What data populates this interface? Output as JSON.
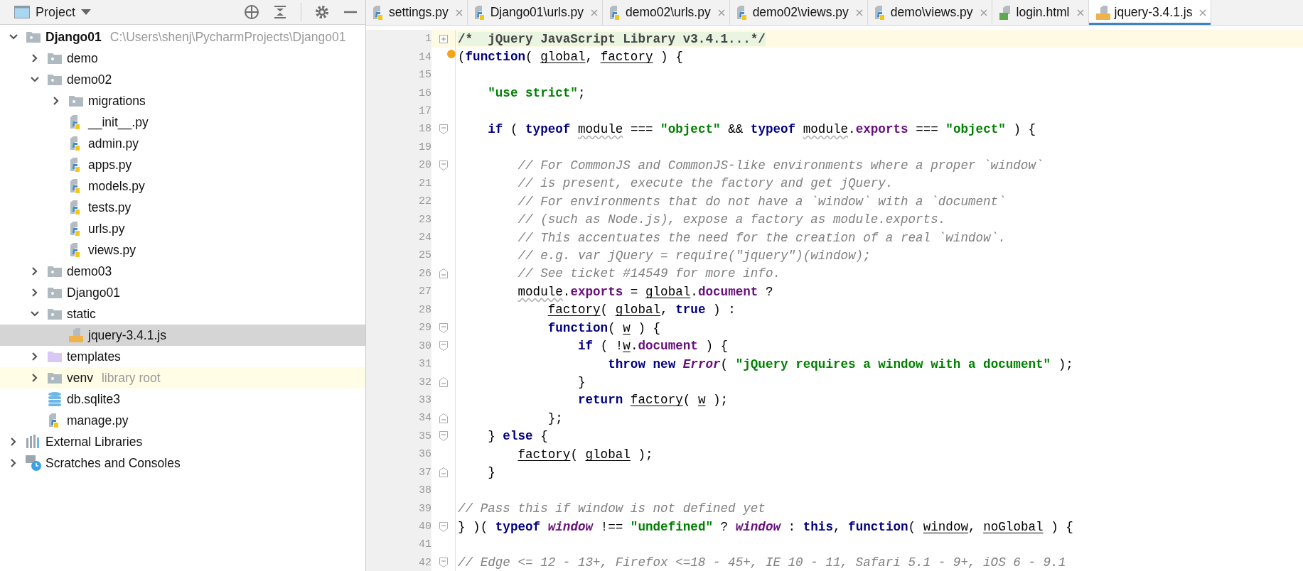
{
  "project_panel": {
    "title": "Project",
    "tree": [
      {
        "label": "Django01",
        "kind": "project",
        "hint": "C:\\Users\\shenj\\PycharmProjects\\Django01",
        "expanded": true,
        "selected": false,
        "children": [
          {
            "label": "demo",
            "kind": "folder",
            "expanded": false,
            "selected": false
          },
          {
            "label": "demo02",
            "kind": "folder",
            "expanded": true,
            "selected": false,
            "children": [
              {
                "label": "migrations",
                "kind": "folder",
                "expanded": false,
                "selected": false
              },
              {
                "label": "__init__.py",
                "kind": "python",
                "selected": false
              },
              {
                "label": "admin.py",
                "kind": "python",
                "selected": false
              },
              {
                "label": "apps.py",
                "kind": "python",
                "selected": false
              },
              {
                "label": "models.py",
                "kind": "python",
                "selected": false
              },
              {
                "label": "tests.py",
                "kind": "python",
                "selected": false
              },
              {
                "label": "urls.py",
                "kind": "python",
                "selected": false
              },
              {
                "label": "views.py",
                "kind": "python",
                "selected": false
              }
            ]
          },
          {
            "label": "demo03",
            "kind": "folder",
            "expanded": false,
            "selected": false
          },
          {
            "label": "Django01",
            "kind": "folder",
            "expanded": false,
            "selected": false
          },
          {
            "label": "static",
            "kind": "folder",
            "expanded": true,
            "selected": false,
            "children": [
              {
                "label": "jquery-3.4.1.js",
                "kind": "js",
                "selected": true
              }
            ]
          },
          {
            "label": "templates",
            "kind": "templates",
            "expanded": false,
            "selected": false
          },
          {
            "label": "venv",
            "kind": "folder",
            "hint": "library root",
            "expanded": false,
            "selected": false,
            "highlighted": true
          },
          {
            "label": "db.sqlite3",
            "kind": "database",
            "selected": false
          },
          {
            "label": "manage.py",
            "kind": "python",
            "selected": false
          }
        ]
      },
      {
        "label": "External Libraries",
        "kind": "libraries",
        "expanded": false,
        "selected": false
      },
      {
        "label": "Scratches and Consoles",
        "kind": "scratches",
        "expanded": false,
        "selected": false
      }
    ]
  },
  "editor": {
    "tabs": [
      {
        "label": "settings.py",
        "kind": "python",
        "selected": false
      },
      {
        "label": "Django01\\urls.py",
        "kind": "python",
        "selected": false
      },
      {
        "label": "demo02\\urls.py",
        "kind": "python",
        "selected": false
      },
      {
        "label": "demo02\\views.py",
        "kind": "python",
        "selected": false
      },
      {
        "label": "demo\\views.py",
        "kind": "python",
        "selected": false
      },
      {
        "label": "login.html",
        "kind": "html",
        "selected": false
      },
      {
        "label": "jquery-3.4.1.js",
        "kind": "js",
        "selected": true
      }
    ],
    "lines": [
      {
        "number": "1",
        "current": true,
        "folded": true,
        "tokens": [
          {
            "kind": "folded",
            "text": "/*  jQuery JavaScript Library v3.4.1...*/"
          }
        ]
      },
      {
        "number": "14",
        "current": false,
        "intention_bulb": true,
        "tokens": [
          {
            "kind": "plain",
            "text": "("
          },
          {
            "kind": "keyword",
            "text": "function"
          },
          {
            "kind": "plain",
            "text": "( "
          },
          {
            "kind": "param",
            "text": "global"
          },
          {
            "kind": "plain",
            "text": ", "
          },
          {
            "kind": "param",
            "text": "factory"
          },
          {
            "kind": "plain",
            "text": " ) {"
          }
        ]
      },
      {
        "number": "15",
        "current": false
      },
      {
        "number": "16",
        "current": false,
        "tokens": [
          {
            "kind": "string",
            "text": "    \"use strict\""
          },
          {
            "kind": "plain",
            "text": ";"
          }
        ]
      },
      {
        "number": "17",
        "current": false
      },
      {
        "number": "18",
        "current": false,
        "fold_start": true,
        "tokens": [
          {
            "kind": "keyword",
            "text": "    if"
          },
          {
            "kind": "plain",
            "text": " ( "
          },
          {
            "kind": "keyword",
            "text": "typeof "
          },
          {
            "kind": "warning",
            "text": "module"
          },
          {
            "kind": "plain",
            "text": " === "
          },
          {
            "kind": "string",
            "text": "\"object\""
          },
          {
            "kind": "plain",
            "text": " && "
          },
          {
            "kind": "keyword",
            "text": "typeof "
          },
          {
            "kind": "warning",
            "text": "module"
          },
          {
            "kind": "plain",
            "text": "."
          },
          {
            "kind": "property",
            "text": "exports"
          },
          {
            "kind": "plain",
            "text": " === "
          },
          {
            "kind": "string",
            "text": "\"object\""
          },
          {
            "kind": "plain",
            "text": " ) {"
          }
        ]
      },
      {
        "number": "19",
        "current": false
      },
      {
        "number": "20",
        "current": false,
        "fold_start": true,
        "tokens": [
          {
            "kind": "comment",
            "text": "        // For CommonJS and CommonJS-like environments where a proper `window`"
          }
        ]
      },
      {
        "number": "21",
        "current": false,
        "tokens": [
          {
            "kind": "comment",
            "text": "        // is present, execute the factory and get jQuery."
          }
        ]
      },
      {
        "number": "22",
        "current": false,
        "tokens": [
          {
            "kind": "comment",
            "text": "        // For environments that do not have a `window` with a `document`"
          }
        ]
      },
      {
        "number": "23",
        "current": false,
        "tokens": [
          {
            "kind": "comment",
            "text": "        // (such as Node.js), expose a factory as module.exports."
          }
        ]
      },
      {
        "number": "24",
        "current": false,
        "tokens": [
          {
            "kind": "comment",
            "text": "        // This accentuates the need for the creation of a real `window`."
          }
        ]
      },
      {
        "number": "25",
        "current": false,
        "tokens": [
          {
            "kind": "comment",
            "text": "        // e.g. var jQuery = require(\"jquery\")(window);"
          }
        ]
      },
      {
        "number": "26",
        "current": false,
        "fold_end": true,
        "tokens": [
          {
            "kind": "comment",
            "text": "        // See ticket #14549 for more info."
          }
        ]
      },
      {
        "number": "27",
        "current": false,
        "tokens": [
          {
            "kind": "warning",
            "text": "        module"
          },
          {
            "kind": "plain",
            "text": "."
          },
          {
            "kind": "property",
            "text": "exports"
          },
          {
            "kind": "plain",
            "text": " = "
          },
          {
            "kind": "param",
            "text": "global"
          },
          {
            "kind": "plain",
            "text": "."
          },
          {
            "kind": "property",
            "text": "document"
          },
          {
            "kind": "plain",
            "text": " ?"
          }
        ]
      },
      {
        "number": "28",
        "current": false,
        "tokens": [
          {
            "kind": "param",
            "text": "            factory"
          },
          {
            "kind": "plain",
            "text": "( "
          },
          {
            "kind": "param",
            "text": "global"
          },
          {
            "kind": "plain",
            "text": ", "
          },
          {
            "kind": "keyword",
            "text": "true"
          },
          {
            "kind": "plain",
            "text": " ) :"
          }
        ]
      },
      {
        "number": "29",
        "current": false,
        "fold_start": true,
        "tokens": [
          {
            "kind": "keyword",
            "text": "            function"
          },
          {
            "kind": "plain",
            "text": "( "
          },
          {
            "kind": "param",
            "text": "w"
          },
          {
            "kind": "plain",
            "text": " ) {"
          }
        ]
      },
      {
        "number": "30",
        "current": false,
        "fold_start": true,
        "tokens": [
          {
            "kind": "keyword",
            "text": "                if"
          },
          {
            "kind": "plain",
            "text": " ( !"
          },
          {
            "kind": "param",
            "text": "w"
          },
          {
            "kind": "plain",
            "text": "."
          },
          {
            "kind": "property",
            "text": "document"
          },
          {
            "kind": "plain",
            "text": " ) {"
          }
        ]
      },
      {
        "number": "31",
        "current": false,
        "tokens": [
          {
            "kind": "keyword",
            "text": "                    throw new "
          },
          {
            "kind": "global",
            "text": "Error"
          },
          {
            "kind": "plain",
            "text": "( "
          },
          {
            "kind": "string",
            "text": "\"jQuery requires a window with a document\""
          },
          {
            "kind": "plain",
            "text": " );"
          }
        ]
      },
      {
        "number": "32",
        "current": false,
        "fold_end": true,
        "tokens": [
          {
            "kind": "plain",
            "text": "                }"
          }
        ]
      },
      {
        "number": "33",
        "current": false,
        "tokens": [
          {
            "kind": "keyword",
            "text": "                return "
          },
          {
            "kind": "param",
            "text": "factory"
          },
          {
            "kind": "plain",
            "text": "( "
          },
          {
            "kind": "param",
            "text": "w"
          },
          {
            "kind": "plain",
            "text": " );"
          }
        ]
      },
      {
        "number": "34",
        "current": false,
        "fold_end": true,
        "tokens": [
          {
            "kind": "plain",
            "text": "            };"
          }
        ]
      },
      {
        "number": "35",
        "current": false,
        "fold_start": true,
        "tokens": [
          {
            "kind": "plain",
            "text": "    } "
          },
          {
            "kind": "keyword",
            "text": "else"
          },
          {
            "kind": "plain",
            "text": " {"
          }
        ]
      },
      {
        "number": "36",
        "current": false,
        "tokens": [
          {
            "kind": "param",
            "text": "        factory"
          },
          {
            "kind": "plain",
            "text": "( "
          },
          {
            "kind": "param",
            "text": "global"
          },
          {
            "kind": "plain",
            "text": " );"
          }
        ]
      },
      {
        "number": "37",
        "current": false,
        "fold_end": true,
        "tokens": [
          {
            "kind": "plain",
            "text": "    }"
          }
        ]
      },
      {
        "number": "38",
        "current": false
      },
      {
        "number": "39",
        "current": false,
        "tokens": [
          {
            "kind": "comment",
            "text": "// Pass this if window is not defined yet"
          }
        ]
      },
      {
        "number": "40",
        "current": false,
        "fold_start": true,
        "tokens": [
          {
            "kind": "plain",
            "text": "} )( "
          },
          {
            "kind": "keyword",
            "text": "typeof "
          },
          {
            "kind": "global",
            "text": "window"
          },
          {
            "kind": "plain",
            "text": " !== "
          },
          {
            "kind": "string",
            "text": "\"undefined\""
          },
          {
            "kind": "plain",
            "text": " ? "
          },
          {
            "kind": "global",
            "text": "window"
          },
          {
            "kind": "plain",
            "text": " : "
          },
          {
            "kind": "keyword",
            "text": "this"
          },
          {
            "kind": "plain",
            "text": ", "
          },
          {
            "kind": "keyword",
            "text": "function"
          },
          {
            "kind": "plain",
            "text": "( "
          },
          {
            "kind": "param",
            "text": "window"
          },
          {
            "kind": "plain",
            "text": ", "
          },
          {
            "kind": "param",
            "text": "noGlobal"
          },
          {
            "kind": "plain",
            "text": " ) {"
          }
        ]
      },
      {
        "number": "41",
        "current": false
      },
      {
        "number": "42",
        "current": false,
        "fold_start": true,
        "tokens": [
          {
            "kind": "comment",
            "text": "// Edge <= 12 - 13+, Firefox <=18 - 45+, IE 10 - 11, Safari 5.1 - 9+, iOS 6 - 9.1"
          }
        ]
      }
    ]
  }
}
